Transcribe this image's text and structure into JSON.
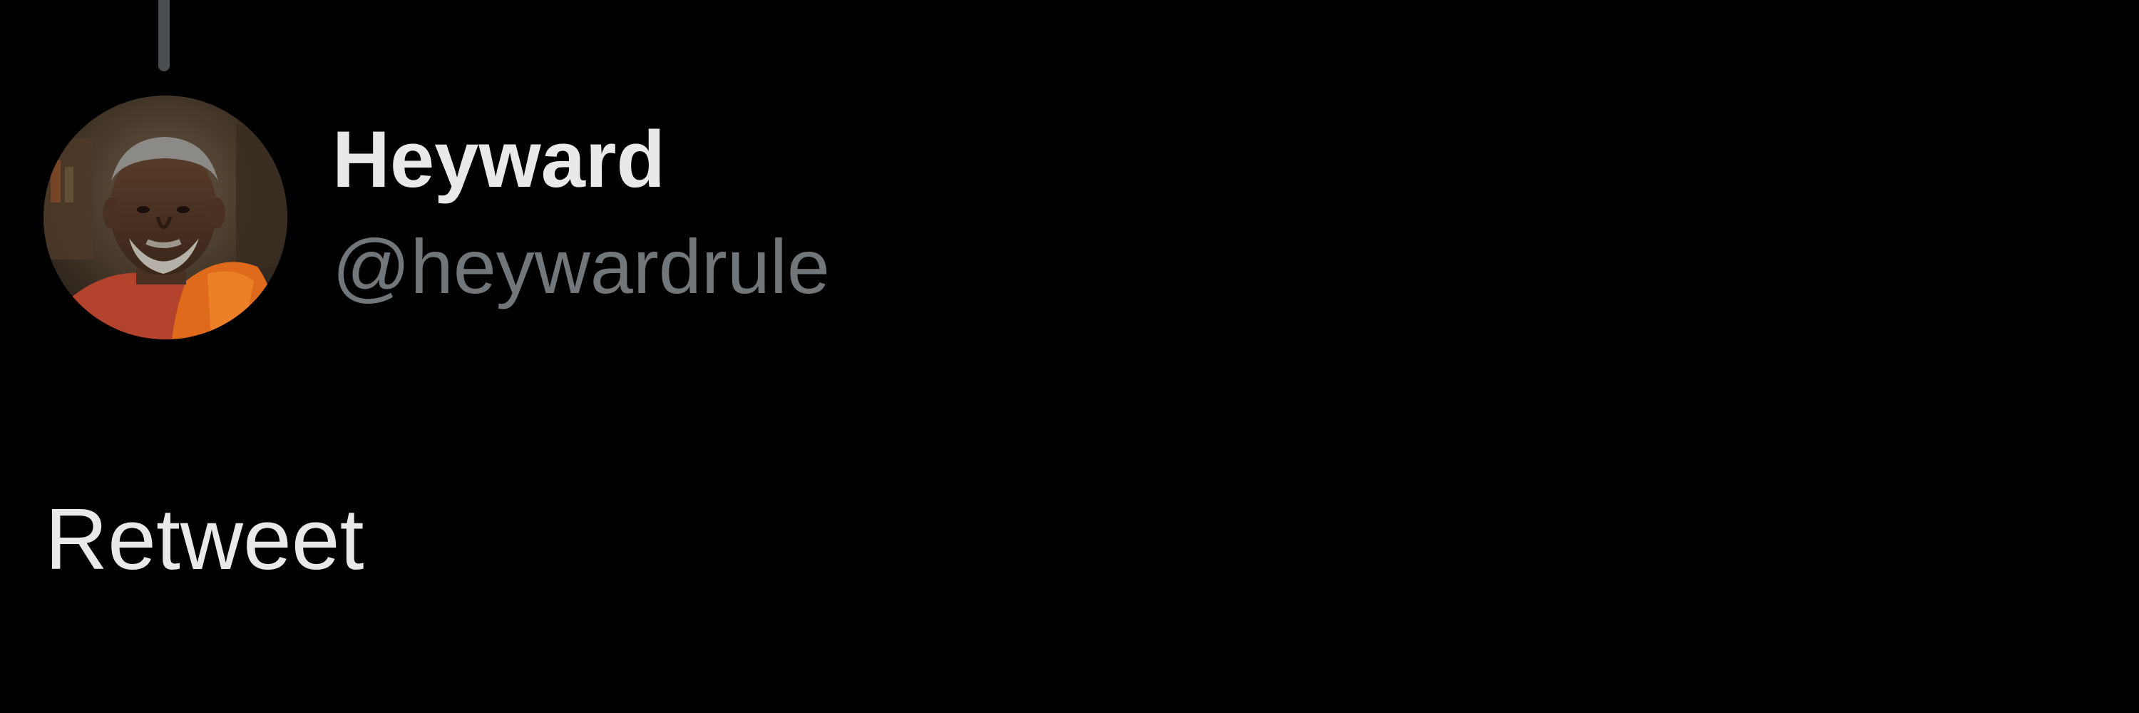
{
  "tweet": {
    "author": {
      "display_name": "Heyward",
      "handle": "@heywardrule",
      "avatar_icon": "profile-photo"
    },
    "text": "Retweet"
  },
  "colors": {
    "background": "#000000",
    "primary_text": "#e7e9ea",
    "secondary_text": "#71767b",
    "thread_line": "#4a4d52"
  }
}
